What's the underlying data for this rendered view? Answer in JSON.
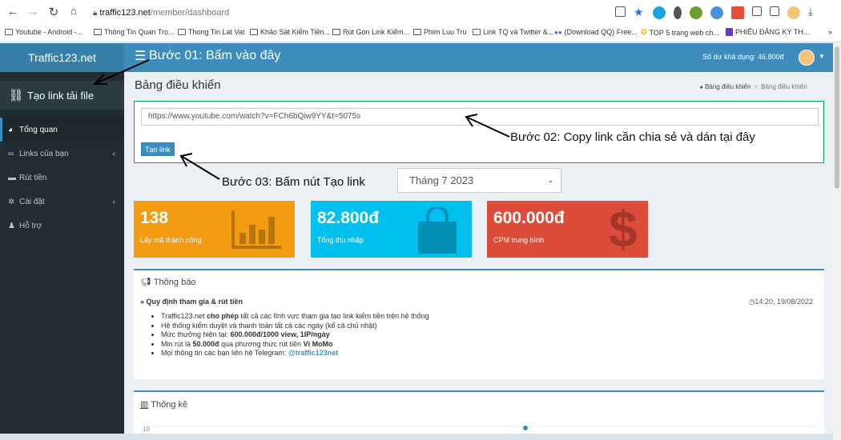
{
  "browser": {
    "url_domain": "traffic123.net",
    "url_path": "/member/dashboard",
    "bookmarks": [
      "Youtube - Android -...",
      "Thông Tin Quan Trọ...",
      "Thong Tin Lat Vat",
      "Khảo Sát Kiếm Tiền...",
      "Rút Gọn Link Kiếm...",
      "Phim Luu Tru",
      "Link TQ và Twitter &...",
      "(Download QQ) Free...",
      "TOP 5 trang web ch...",
      "PHIẾU ĐĂNG KÝ TH..."
    ],
    "more_bookmarks": "»"
  },
  "header": {
    "logo": "Traffic123.net",
    "step1": "Bước 01: Bấm vào đây",
    "balance": "Số dư khả dụng: 46.800đ"
  },
  "sidebar": {
    "create_link": "Tạo link tải file",
    "items": [
      {
        "label": "Tổng quan",
        "icon": "dashboard-icon",
        "active": true
      },
      {
        "label": "Links của bạn",
        "icon": "link-icon",
        "has_children": true
      },
      {
        "label": "Rút tiền",
        "icon": "wallet-icon"
      },
      {
        "label": "Cài đặt",
        "icon": "gear-icon",
        "has_children": true
      },
      {
        "label": "Hỗ trợ",
        "icon": "bell-icon"
      }
    ]
  },
  "page": {
    "title": "Bảng điều khiển",
    "breadcrumb": [
      "Bảng điều khiển",
      "Bảng điều khiển"
    ]
  },
  "link_form": {
    "url_value": "https://www.youtube.com/watch?v=FCh6bQiw9YY&t=5075s",
    "button": "Tạo link"
  },
  "annotations": {
    "step2": "Bước 02: Copy link cần chia sẻ và dán tại đây",
    "step3": "Bước 03: Bấm nút Tạo link"
  },
  "month": {
    "selected": "Tháng 7 2023"
  },
  "stats": [
    {
      "value": "138",
      "label": "Lấy mã thành công",
      "color": "#f39c12",
      "icon": "bar-chart-icon"
    },
    {
      "value": "82.800đ",
      "label": "Tổng thu nhập",
      "color": "#00c0ef",
      "icon": "shopping-bag-icon"
    },
    {
      "value": "600.000đ",
      "label": "CPM trung bình",
      "color": "#dd4b39",
      "icon": "dollar-icon"
    }
  ],
  "notice": {
    "title": "Thông báo",
    "rule_title": "» Quy định tham gia & rút tiền",
    "time": "14:20, 19/08/2022",
    "rules": [
      {
        "pre": "Traffic123.net ",
        "bold": "cho phép",
        "post": " tất cả các lĩnh vực tham gia tạo link kiếm tiền trên hệ thống"
      },
      {
        "pre": "Hệ thống kiểm duyệt và thanh toán tất cả các ngày (kể cả chủ nhật)",
        "bold": "",
        "post": ""
      },
      {
        "pre": "Mức thưởng hiện tại: ",
        "bold": "600.000đ/1000 view, 1IP/ngày",
        "post": ""
      },
      {
        "pre": "Min rút là ",
        "bold": "50.000đ",
        "post": " qua phương thức rút tiền ",
        "bold2": "Ví MoMo"
      },
      {
        "pre": "Mọi thông tin các bạn liên hệ Telegram: ",
        "link": "@traffic123net"
      }
    ]
  },
  "statistics": {
    "title": "Thống kê",
    "y_tick": "10"
  }
}
